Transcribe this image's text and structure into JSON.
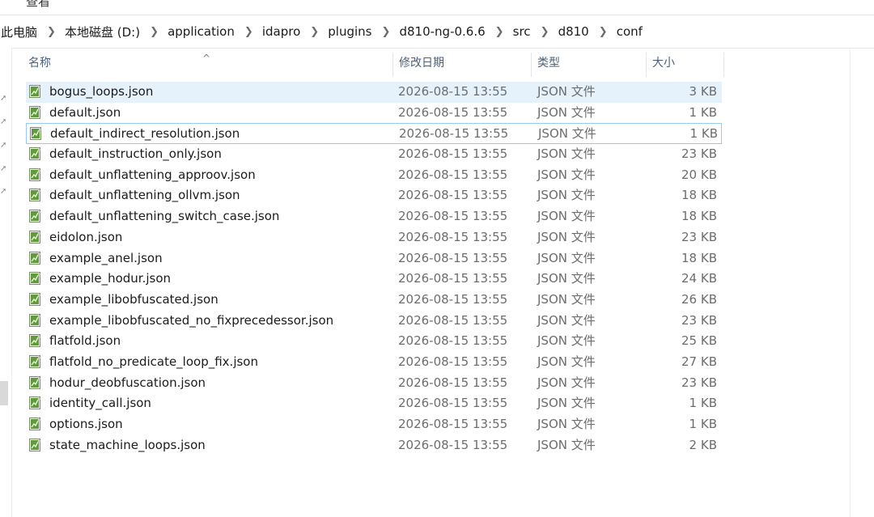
{
  "top_menu": {
    "label": "查看"
  },
  "breadcrumb": [
    "此电脑",
    "本地磁盘 (D:)",
    "application",
    "idapro",
    "plugins",
    "d810-ng-0.6.6",
    "src",
    "d810",
    "conf"
  ],
  "columns": {
    "name": "名称",
    "date": "修改日期",
    "type": "类型",
    "size": "大小"
  },
  "sort_indicator": "^",
  "files": [
    {
      "name": "bogus_loops.json",
      "date": "2026-08-15 13:55",
      "type": "JSON 文件",
      "size": "3 KB"
    },
    {
      "name": "default.json",
      "date": "2026-08-15 13:55",
      "type": "JSON 文件",
      "size": "1 KB"
    },
    {
      "name": "default_indirect_resolution.json",
      "date": "2026-08-15 13:55",
      "type": "JSON 文件",
      "size": "1 KB"
    },
    {
      "name": "default_instruction_only.json",
      "date": "2026-08-15 13:55",
      "type": "JSON 文件",
      "size": "23 KB"
    },
    {
      "name": "default_unflattening_approov.json",
      "date": "2026-08-15 13:55",
      "type": "JSON 文件",
      "size": "20 KB"
    },
    {
      "name": "default_unflattening_ollvm.json",
      "date": "2026-08-15 13:55",
      "type": "JSON 文件",
      "size": "18 KB"
    },
    {
      "name": "default_unflattening_switch_case.json",
      "date": "2026-08-15 13:55",
      "type": "JSON 文件",
      "size": "18 KB"
    },
    {
      "name": "eidolon.json",
      "date": "2026-08-15 13:55",
      "type": "JSON 文件",
      "size": "23 KB"
    },
    {
      "name": "example_anel.json",
      "date": "2026-08-15 13:55",
      "type": "JSON 文件",
      "size": "18 KB"
    },
    {
      "name": "example_hodur.json",
      "date": "2026-08-15 13:55",
      "type": "JSON 文件",
      "size": "24 KB"
    },
    {
      "name": "example_libobfuscated.json",
      "date": "2026-08-15 13:55",
      "type": "JSON 文件",
      "size": "26 KB"
    },
    {
      "name": "example_libobfuscated_no_fixprecedessor.json",
      "date": "2026-08-15 13:55",
      "type": "JSON 文件",
      "size": "23 KB"
    },
    {
      "name": "flatfold.json",
      "date": "2026-08-15 13:55",
      "type": "JSON 文件",
      "size": "25 KB"
    },
    {
      "name": "flatfold_no_predicate_loop_fix.json",
      "date": "2026-08-15 13:55",
      "type": "JSON 文件",
      "size": "27 KB"
    },
    {
      "name": "hodur_deobfuscation.json",
      "date": "2026-08-15 13:55",
      "type": "JSON 文件",
      "size": "23 KB"
    },
    {
      "name": "identity_call.json",
      "date": "2026-08-15 13:55",
      "type": "JSON 文件",
      "size": "1 KB"
    },
    {
      "name": "options.json",
      "date": "2026-08-15 13:55",
      "type": "JSON 文件",
      "size": "1 KB"
    },
    {
      "name": "state_machine_loops.json",
      "date": "2026-08-15 13:55",
      "type": "JSON 文件",
      "size": "2 KB"
    }
  ],
  "icons": {
    "file": "json-file-icon",
    "pin": "pin-icon",
    "separator": "chevron-right-icon"
  },
  "colors": {
    "selected_row": "#e5f1fb",
    "focus_border": "#99c9ef",
    "header_text": "#4c607a"
  }
}
